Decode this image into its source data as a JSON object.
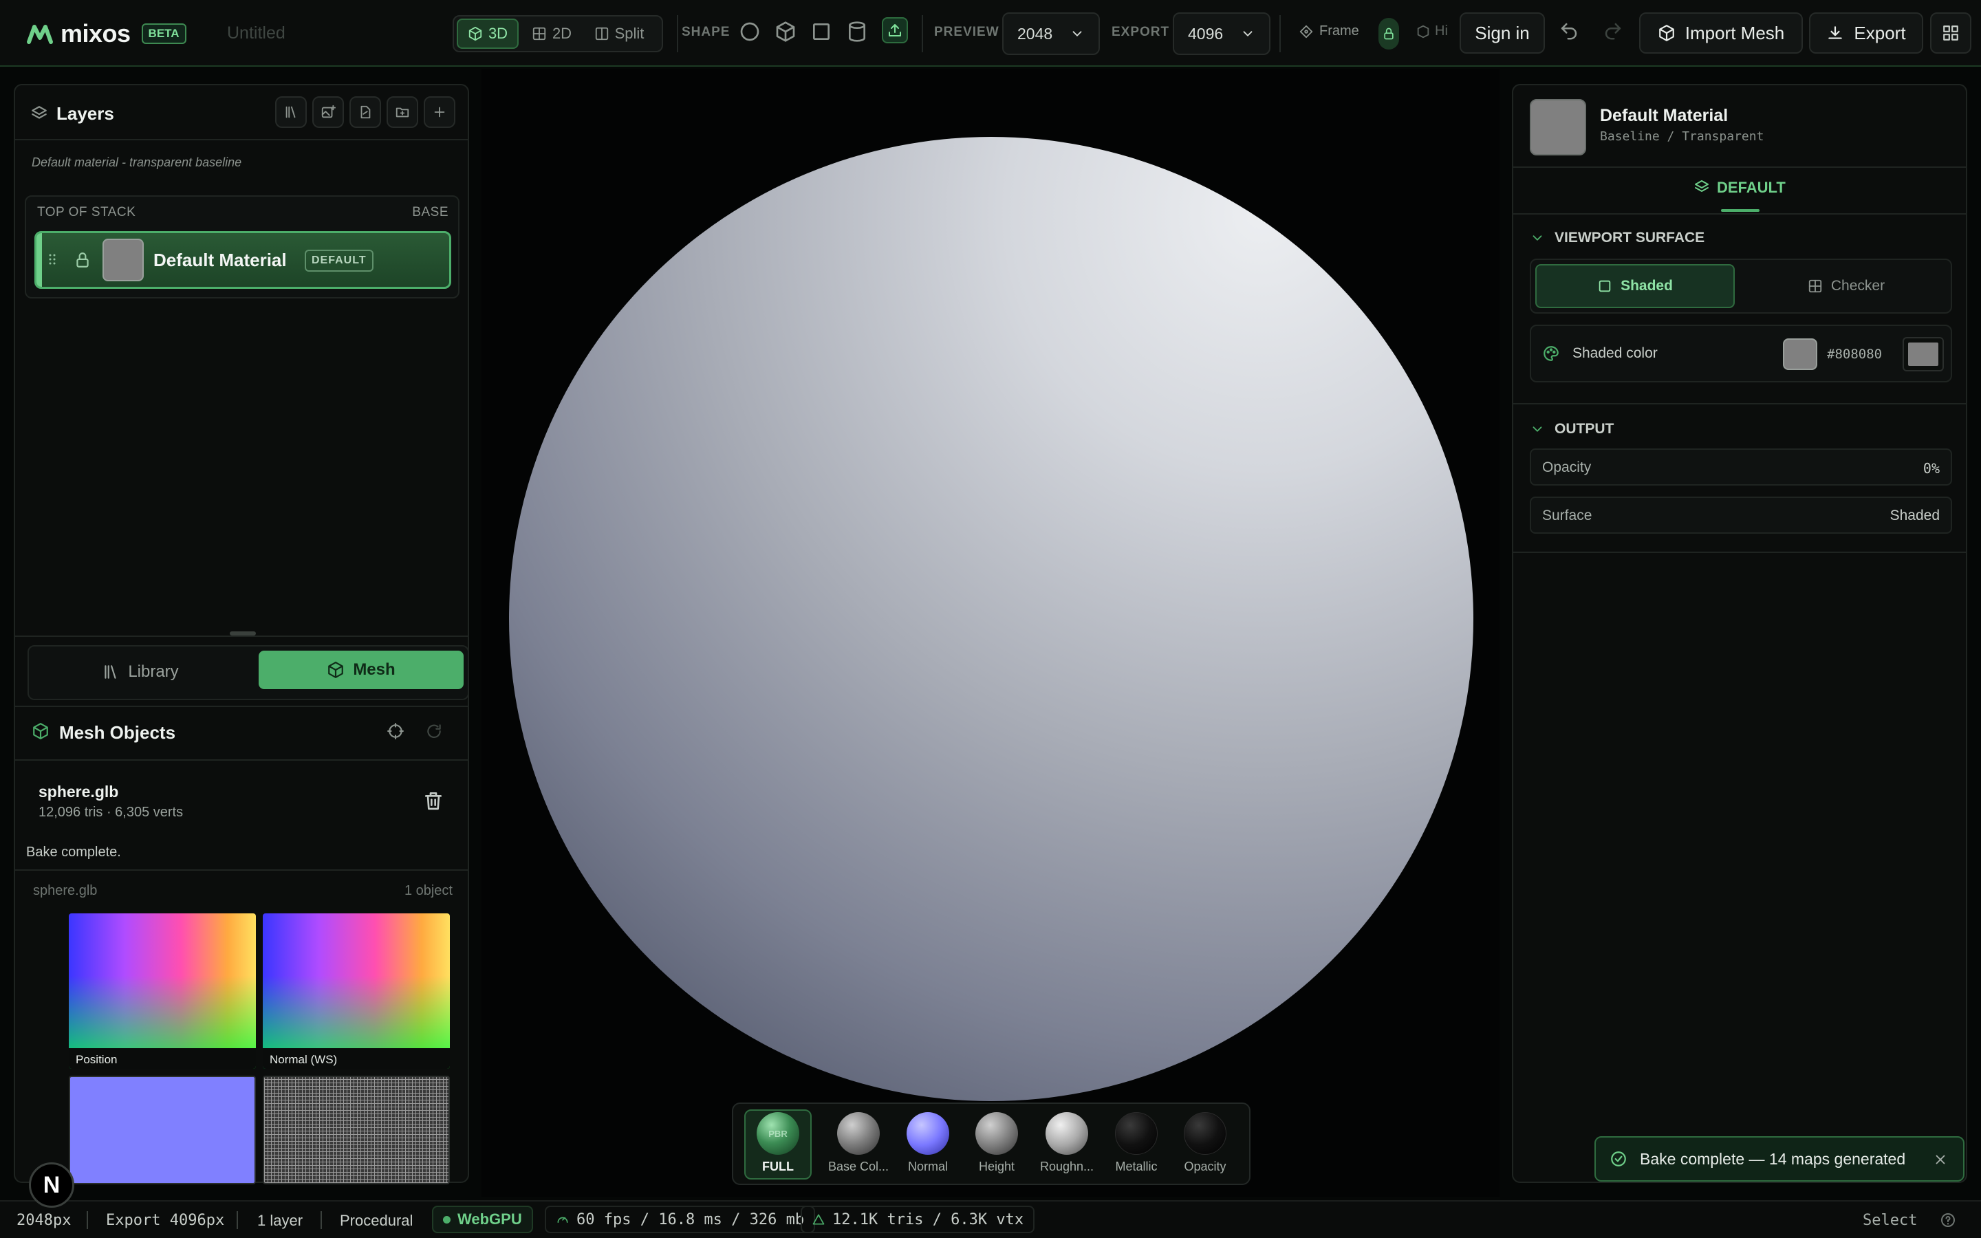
{
  "app": {
    "name": "mixos",
    "badge": "BETA",
    "document_title": "Untitled"
  },
  "toolbar": {
    "view_modes": [
      {
        "label": "3D",
        "icon": "cube-icon"
      },
      {
        "label": "2D",
        "icon": "grid-icon"
      },
      {
        "label": "Split",
        "icon": "split-icon"
      }
    ],
    "shape_label": "SHAPE",
    "shape_icons": [
      "sphere-icon",
      "cube-icon",
      "plane-icon",
      "cylinder-icon",
      "upload-mesh-icon"
    ],
    "preview_label": "PREVIEW",
    "preview_value": "2048",
    "export_label": "EXPORT",
    "export_value": "4096",
    "frame_label": "Frame",
    "hi_label": "Hi",
    "sign_in": "Sign in",
    "import_mesh": "Import Mesh",
    "export": "Export"
  },
  "layers": {
    "title": "Layers",
    "subtitle": "Default material - transparent baseline",
    "stack_top": "TOP OF STACK",
    "stack_base": "BASE",
    "items": [
      {
        "name": "Default Material",
        "tag": "DEFAULT",
        "swatch": "#808080"
      }
    ]
  },
  "tabs": {
    "library": "Library",
    "mesh": "Mesh"
  },
  "mesh": {
    "title": "Mesh Objects",
    "file": "sphere.glb",
    "stats": "12,096 tris · 6,305 verts",
    "status": "Bake complete.",
    "group_name": "sphere.glb",
    "group_count": "1 object",
    "maps": [
      "Position",
      "Normal (WS)",
      "",
      ""
    ]
  },
  "materials": [
    {
      "label": "FULL",
      "badge": "PBR"
    },
    {
      "label": "Base Col..."
    },
    {
      "label": "Normal"
    },
    {
      "label": "Height"
    },
    {
      "label": "Roughn..."
    },
    {
      "label": "Metallic"
    },
    {
      "label": "Opacity"
    }
  ],
  "inspector": {
    "material_name": "Default Material",
    "material_path": "Baseline / Transparent",
    "tab": "DEFAULT",
    "viewport_section": "VIEWPORT SURFACE",
    "shaded": "Shaded",
    "checker": "Checker",
    "shaded_color_label": "Shaded color",
    "shaded_color": "#808080",
    "output_section": "OUTPUT",
    "opacity_label": "Opacity",
    "opacity_value": "0%",
    "surface_label": "Surface",
    "surface_value": "Shaded"
  },
  "toast": "Bake complete — 14 maps generated",
  "status": {
    "preview": "2048px",
    "export": "Export 4096px",
    "layers": "1 layer",
    "mode": "Procedural",
    "backend": "WebGPU",
    "perf": "60 fps / 16.8 ms / 326 mb",
    "geo": "12.1K tris / 6.3K vtx",
    "tool": "Select",
    "avatar": "N"
  },
  "colors": {
    "accent": "#4cae6a",
    "accent_dark": "#1f4a2a",
    "bg": "#050706"
  }
}
